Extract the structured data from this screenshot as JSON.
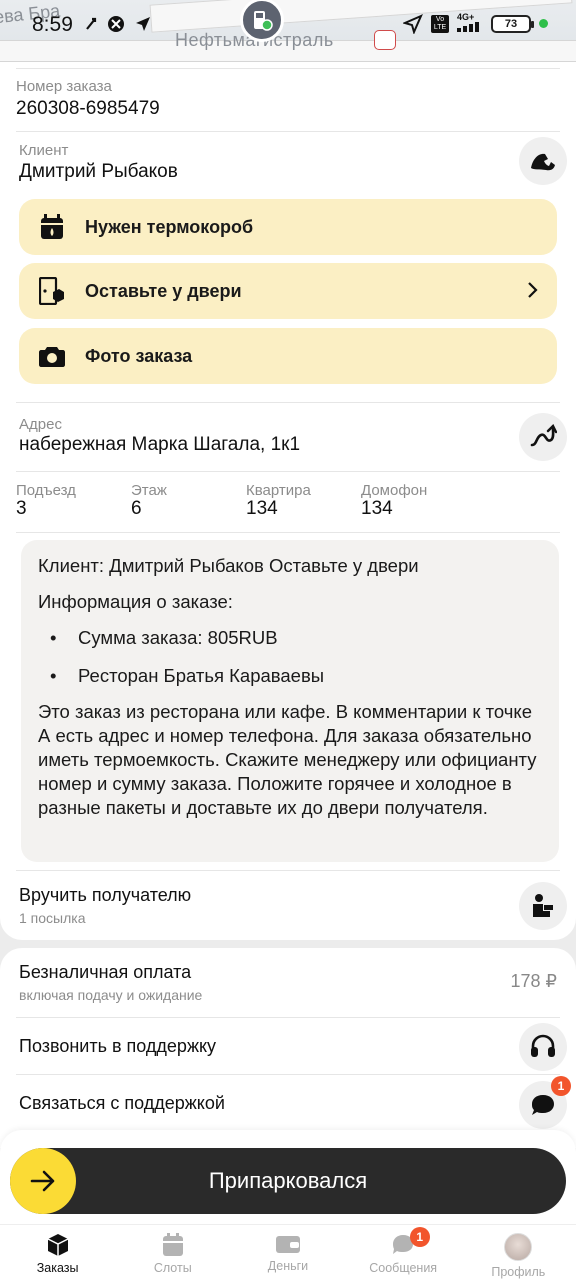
{
  "status_bar": {
    "time": "8:59",
    "battery": "73",
    "network": "4G+",
    "network_sub": "Vo LTE"
  },
  "map": {
    "street_left": "ева Бра",
    "street_name": "Нефтьмагистраль"
  },
  "order": {
    "number_label": "Номер заказа",
    "number": "260308-6985479",
    "client_label": "Клиент",
    "client_name": "Дмитрий Рыбаков"
  },
  "actions": [
    {
      "label": "Нужен термокороб",
      "icon": "thermobox-icon"
    },
    {
      "label": "Оставьте у двери",
      "icon": "door-package-icon",
      "chevron": true
    },
    {
      "label": "Фото заказа",
      "icon": "camera-icon"
    }
  ],
  "address": {
    "label": "Адрес",
    "value": "набережная Марка Шагала, 1к1",
    "details": [
      {
        "label": "Подъезд",
        "value": "3"
      },
      {
        "label": "Этаж",
        "value": "6"
      },
      {
        "label": "Квартира",
        "value": "134"
      },
      {
        "label": "Домофон",
        "value": "134"
      }
    ]
  },
  "comment": {
    "line1": "Клиент: Дмитрий Рыбаков Оставьте у двери",
    "line2": "Информация о заказе:",
    "bullet1": "Сумма заказа: 805RUB",
    "bullet2": "Ресторан Братья Караваевы",
    "paragraph": "Это заказ из ресторана или кафе. В комментарии к точке А есть адрес и номер телефона. Для заказа обязательно иметь термоемкость. Скажите менеджеру или официанту номер и сумму заказа. Положите горячее и холодное в разные пакеты и доставьте их до двери получателя."
  },
  "handover": {
    "title": "Вручить получателю",
    "subtitle": "1 посылка"
  },
  "payment": {
    "title": "Безналичная оплата",
    "subtitle": "включая подачу и ожидание",
    "amount": "178 ₽"
  },
  "support": {
    "call_label": "Позвонить в поддержку",
    "chat_label": "Связаться с поддержкой",
    "chat_badge": "1"
  },
  "main_button": {
    "label": "Припарковался"
  },
  "tabs": [
    {
      "label": "Заказы",
      "active": true
    },
    {
      "label": "Слоты"
    },
    {
      "label": "Деньги"
    },
    {
      "label": "Сообщения",
      "badge": "1"
    },
    {
      "label": "Профиль"
    }
  ],
  "colors": {
    "accent_yellow": "#fbdb35",
    "action_bg": "#fbefc4",
    "badge": "#f2552c",
    "dark_button": "#2a2a2a"
  }
}
